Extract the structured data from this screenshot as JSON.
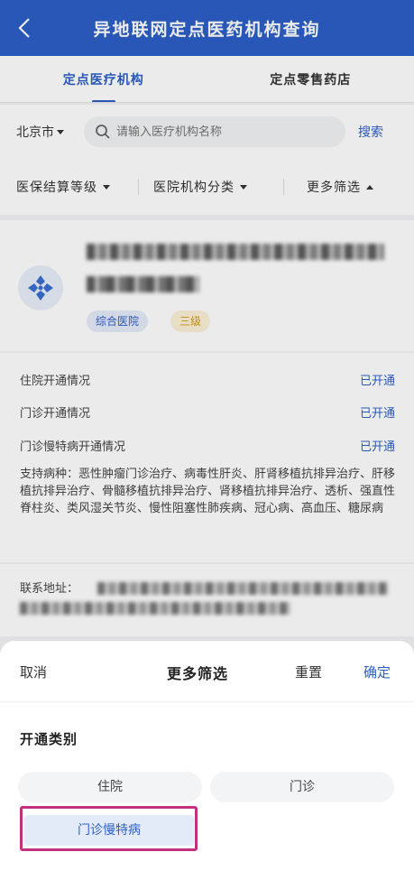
{
  "header": {
    "title": "异地联网定点医药机构查询",
    "back_icon": "chevron-left-icon"
  },
  "tabs": [
    {
      "label": "定点医疗机构",
      "active": true
    },
    {
      "label": "定点零售药店",
      "active": false
    }
  ],
  "search": {
    "city": "北京市",
    "placeholder": "请输入医疗机构名称",
    "button": "搜索"
  },
  "filters": {
    "level": "医保结算等级",
    "category": "医院机构分类",
    "more": "更多筛选"
  },
  "card": {
    "tags": [
      "综合医院",
      "三级"
    ]
  },
  "info": {
    "rows": [
      {
        "label": "住院开通情况",
        "value": "已开通"
      },
      {
        "label": "门诊开通情况",
        "value": "已开通"
      },
      {
        "label": "门诊慢特病开通情况",
        "value": "已开通"
      }
    ],
    "diseases": "支持病种：恶性肿瘤门诊治疗、病毒性肝炎、肝肾移植抗排异治疗、肝移植抗排异治疗、骨髓移植抗排异治疗、肾移植抗排异治疗、透析、强直性脊柱炎、类风湿关节炎、慢性阻塞性肺疾病、冠心病、高血压、糖尿病",
    "address_label": "联系地址："
  },
  "sheet": {
    "cancel": "取消",
    "title": "更多筛选",
    "reset": "重置",
    "confirm": "确定",
    "section": "开通类别",
    "options": [
      "住院",
      "门诊",
      "门诊慢特病"
    ],
    "selected": "门诊慢特病"
  },
  "colors": {
    "primary": "#2c5fc7",
    "highlight": "#c2307e"
  }
}
